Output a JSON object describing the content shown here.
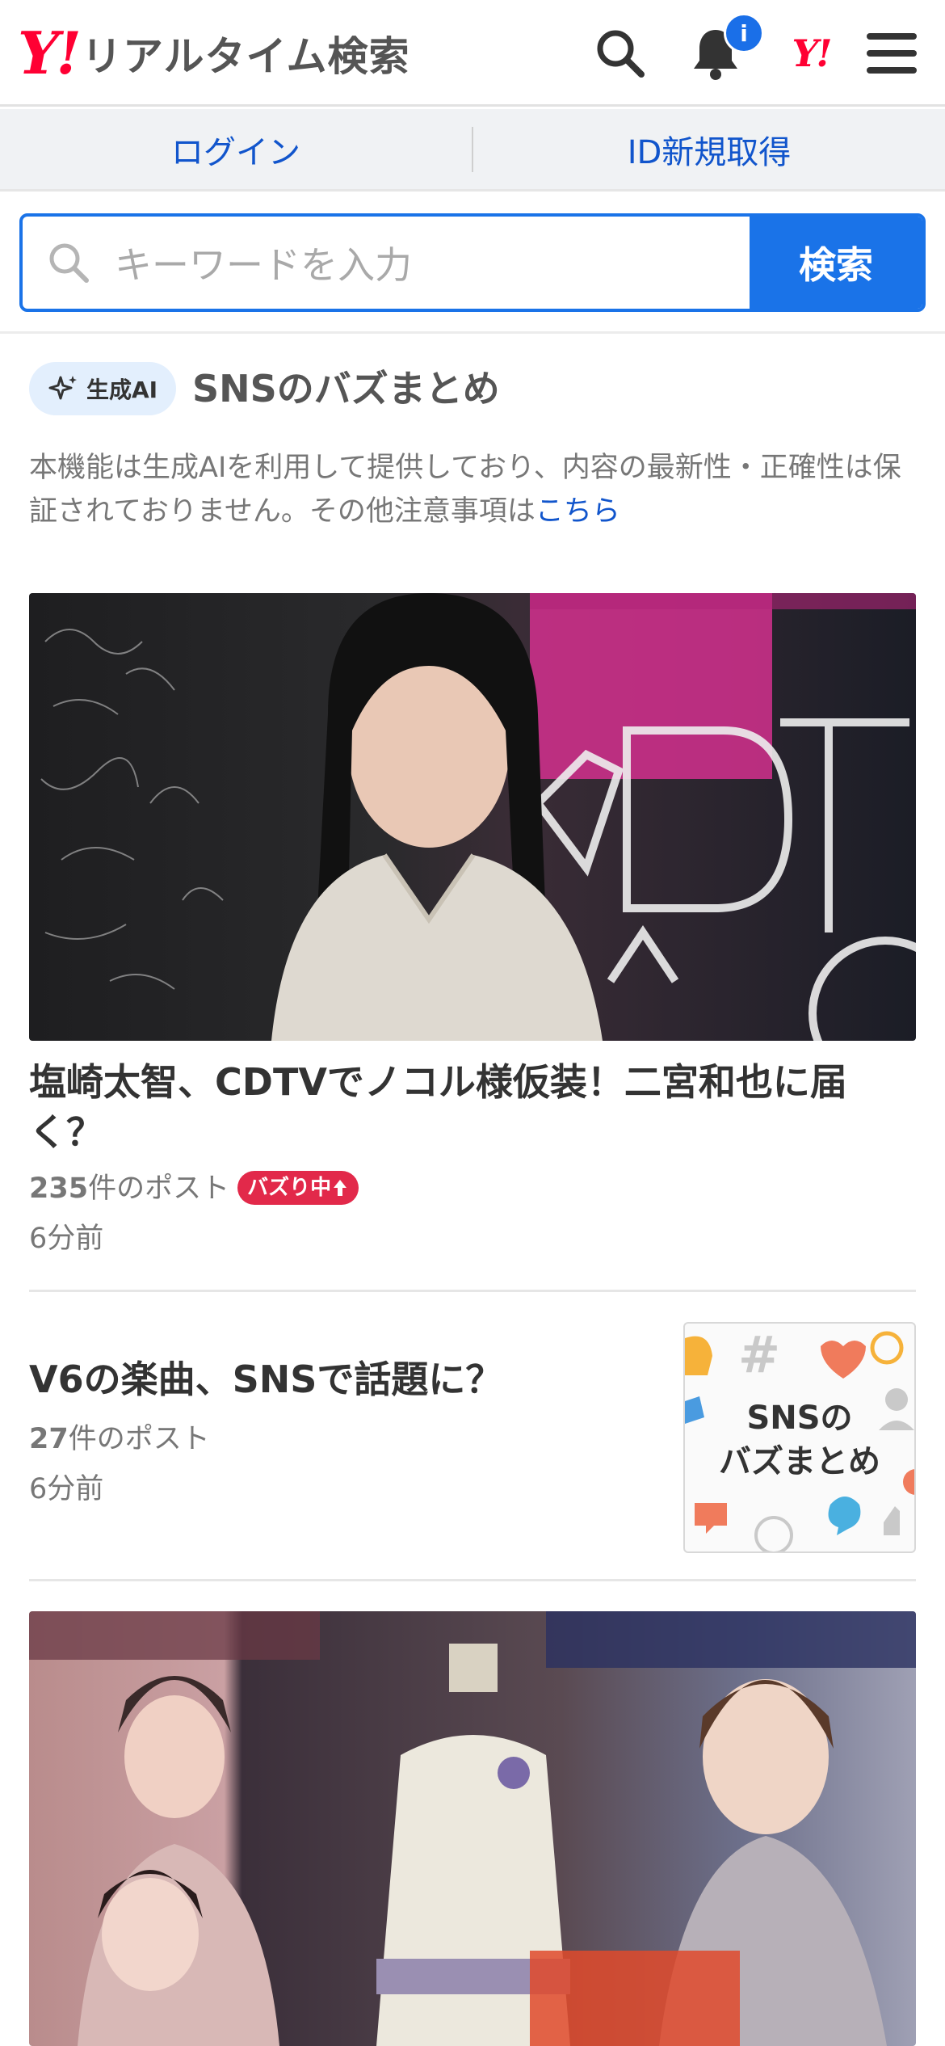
{
  "header": {
    "logo_mark": "Y!",
    "logo_text": "リアルタイム検索",
    "notification_badge": "i",
    "yj_mark": "Y!",
    "icons": [
      "search-icon",
      "bell-icon",
      "yahoo-japan-icon",
      "menu-icon"
    ]
  },
  "login_bar": {
    "login_label": "ログイン",
    "register_label": "ID新規取得"
  },
  "search": {
    "placeholder": "キーワードを入力",
    "button_label": "検索"
  },
  "sns_section": {
    "ai_badge": "生成AI",
    "title": "SNSのバズまとめ",
    "disclaimer": "本機能は生成AIを利用して提供しており、内容の最新性・正確性は保証されておりません。その他注意事項は",
    "disclaimer_link": "こちら"
  },
  "articles": [
    {
      "title": "塩崎太智、CDTVでノコル様仮装！二宮和也に届く？",
      "post_count": "235",
      "post_suffix": "件のポスト",
      "buzz_label": "バズり中",
      "time": "6分前"
    },
    {
      "title": "V6の楽曲、SNSで話題に？",
      "post_count": "27",
      "post_suffix": "件のポスト",
      "time": "6分前",
      "thumb_text_line1": "SNSの",
      "thumb_text_line2": "バズまとめ"
    }
  ],
  "colors": {
    "brand_red": "#ff0033",
    "link_blue": "#1155cc",
    "search_blue": "#1a73e8",
    "buzz_red": "#e2294a"
  }
}
